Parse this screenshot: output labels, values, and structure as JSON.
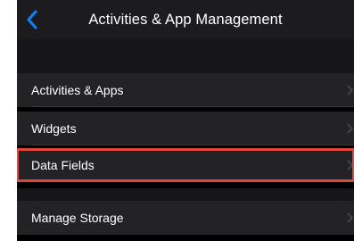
{
  "header": {
    "title": "Activities & App Management",
    "back_icon": "chevron-left-icon"
  },
  "menu": {
    "items": [
      {
        "label": "Activities & Apps"
      },
      {
        "label": "Widgets"
      },
      {
        "label": "Data Fields",
        "highlighted": true
      },
      {
        "label": "Manage Storage"
      }
    ]
  },
  "colors": {
    "accent": "#0a84ff",
    "highlight": "#e0473a",
    "background": "#000000",
    "row": "#232325"
  }
}
